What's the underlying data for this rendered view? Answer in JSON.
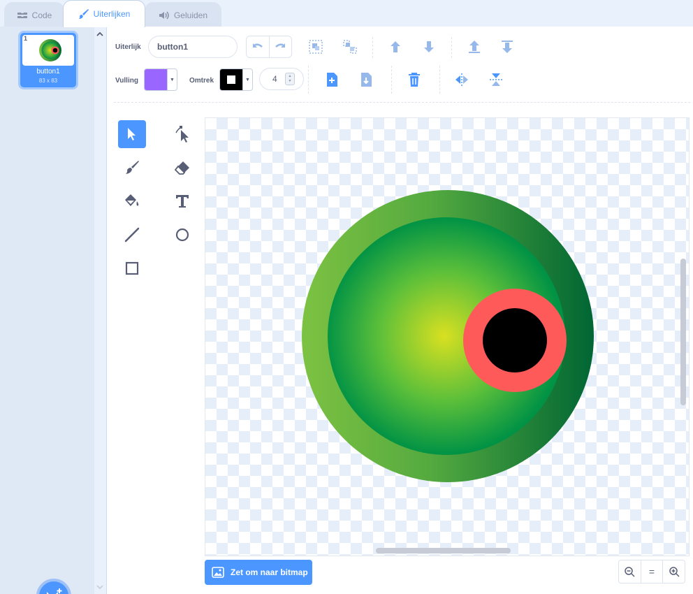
{
  "tabs": [
    {
      "label": "Code",
      "icon": "code-icon",
      "active": false
    },
    {
      "label": "Uiterlijken",
      "icon": "brush-icon",
      "active": true
    },
    {
      "label": "Geluiden",
      "icon": "speaker-icon",
      "active": false
    }
  ],
  "costumes": [
    {
      "number": "1",
      "name": "button1",
      "size": "83 x 83"
    }
  ],
  "toolbar": {
    "costume_label": "Uiterlijk",
    "costume_name": "button1",
    "fill_label": "Vulling",
    "fill_color": "#9966ff",
    "outline_label": "Omtrek",
    "outline_color": "#000000",
    "outline_width": "4"
  },
  "tools": [
    "select",
    "reshape",
    "brush",
    "eraser",
    "fill",
    "text",
    "line",
    "circle",
    "rectangle"
  ],
  "active_tool": "select",
  "bottom": {
    "bitmap_button": "Zet om naar bitmap",
    "zoom_out": "zoom-out-icon",
    "zoom_reset": "=",
    "zoom_in": "zoom-in-icon"
  },
  "colors": {
    "accent": "#4c97ff",
    "ring_outer_light": "#7dc242",
    "ring_outer_dark": "#006633",
    "inner_center": "#d9e021",
    "inner_edge": "#009245",
    "pupil_ring": "#ff5a5a",
    "pupil": "#000000"
  }
}
